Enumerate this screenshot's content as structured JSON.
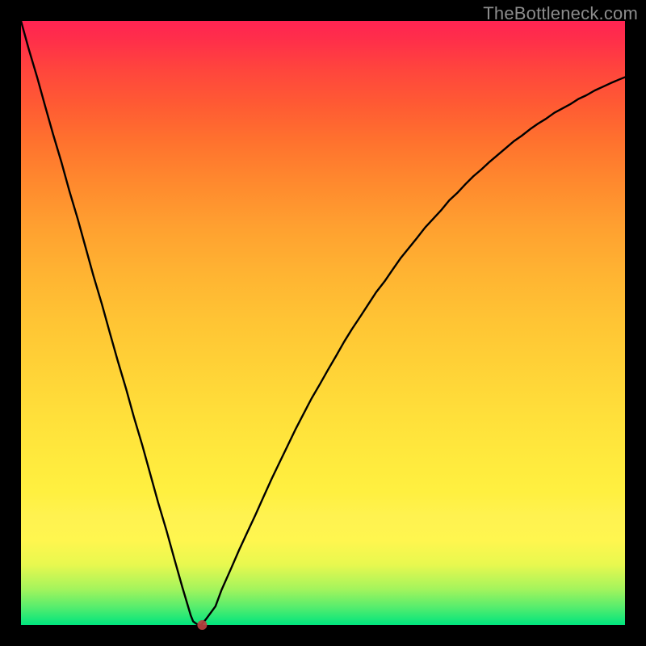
{
  "watermark": {
    "text": "TheBottleneck.com"
  },
  "chart_data": {
    "type": "line",
    "title": "",
    "xlabel": "",
    "ylabel": "",
    "xlim": [
      0,
      1
    ],
    "ylim": [
      0,
      100
    ],
    "legend": false,
    "series": [
      {
        "name": "bottleneck-curve",
        "x": [
          0.0,
          0.013,
          0.027,
          0.04,
          0.053,
          0.067,
          0.08,
          0.094,
          0.107,
          0.12,
          0.134,
          0.147,
          0.16,
          0.174,
          0.187,
          0.201,
          0.214,
          0.227,
          0.241,
          0.254,
          0.267,
          0.281,
          0.285,
          0.289,
          0.294,
          0.299,
          0.301,
          0.305,
          0.311,
          0.322,
          0.332,
          0.348,
          0.361,
          0.374,
          0.388,
          0.401,
          0.415,
          0.428,
          0.441,
          0.455,
          0.468,
          0.481,
          0.495,
          0.508,
          0.522,
          0.535,
          0.548,
          0.562,
          0.575,
          0.588,
          0.602,
          0.615,
          0.629,
          0.642,
          0.655,
          0.669,
          0.682,
          0.695,
          0.709,
          0.722,
          0.736,
          0.749,
          0.762,
          0.776,
          0.789,
          0.802,
          0.816,
          0.829,
          0.843,
          0.856,
          0.869,
          0.883,
          0.896,
          0.909,
          0.923,
          0.936,
          0.95,
          0.963,
          0.976,
          0.99,
          1.0
        ],
        "y": [
          100.0,
          95.3,
          90.6,
          85.9,
          81.3,
          76.6,
          71.9,
          67.2,
          62.5,
          57.8,
          53.1,
          48.4,
          43.8,
          39.1,
          34.4,
          29.7,
          25.0,
          20.3,
          15.6,
          10.9,
          6.3,
          1.6,
          0.6,
          0.3,
          0.0,
          0.0,
          0.4,
          0.8,
          1.6,
          3.1,
          5.8,
          9.4,
          12.4,
          15.2,
          18.2,
          21.1,
          24.2,
          26.9,
          29.6,
          32.5,
          35.0,
          37.5,
          39.9,
          42.2,
          44.6,
          46.9,
          49.0,
          51.1,
          53.1,
          55.1,
          56.9,
          58.8,
          60.8,
          62.4,
          64.0,
          65.8,
          67.2,
          68.6,
          70.3,
          71.5,
          73.0,
          74.3,
          75.4,
          76.7,
          77.8,
          78.9,
          80.1,
          81.0,
          82.1,
          83.0,
          83.8,
          84.8,
          85.5,
          86.2,
          87.1,
          87.7,
          88.5,
          89.1,
          89.7,
          90.3,
          90.7
        ]
      }
    ],
    "marker": {
      "x": 0.3,
      "y": 0.0,
      "color": "#b83f3f",
      "radius": 6
    },
    "gradient_stops": [
      {
        "pos": 0.0,
        "color": "#00e57e"
      },
      {
        "pos": 0.1,
        "color": "#e8f84f"
      },
      {
        "pos": 0.22,
        "color": "#fff040"
      },
      {
        "pos": 0.5,
        "color": "#ffc534"
      },
      {
        "pos": 0.8,
        "color": "#ff722e"
      },
      {
        "pos": 1.0,
        "color": "#ff2452"
      }
    ]
  }
}
